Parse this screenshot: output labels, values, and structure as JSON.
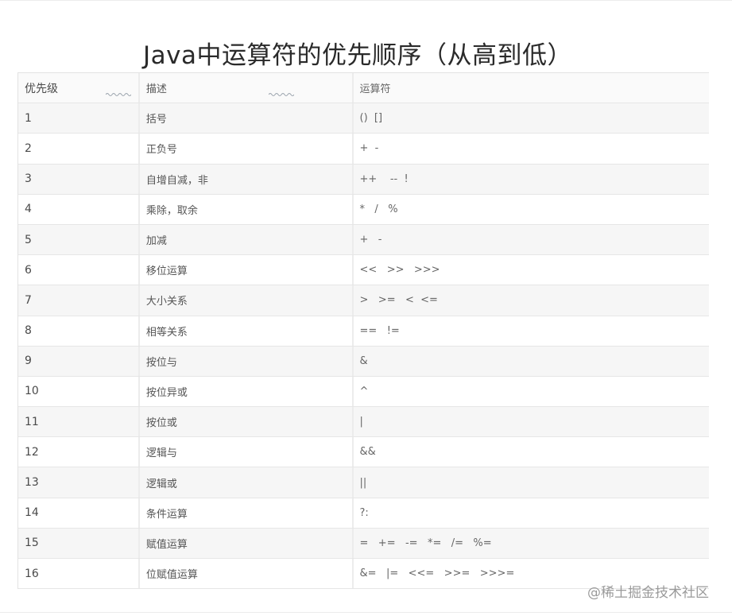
{
  "title": "Java中运算符的优先顺序（从高到低）",
  "table": {
    "headers": [
      "优先级",
      "描述",
      "运算符"
    ],
    "rows": [
      [
        "1",
        "括号",
        "()  []"
      ],
      [
        "2",
        "正负号",
        "+  -"
      ],
      [
        "3",
        "自增自减，非",
        "++    --  !"
      ],
      [
        "4",
        "乘除，取余",
        "*   /   %"
      ],
      [
        "5",
        "加减",
        "+   -"
      ],
      [
        "6",
        "移位运算",
        "<<   >>   >>>"
      ],
      [
        "7",
        "大小关系",
        ">   >=   <  <="
      ],
      [
        "8",
        "相等关系",
        "==   !="
      ],
      [
        "9",
        "按位与",
        "&"
      ],
      [
        "10",
        "按位异或",
        "^"
      ],
      [
        "11",
        "按位或",
        "|"
      ],
      [
        "12",
        "逻辑与",
        "&&"
      ],
      [
        "13",
        "逻辑或",
        "||"
      ],
      [
        "14",
        "条件运算",
        "?:"
      ],
      [
        "15",
        "赋值运算",
        "=   +=   -=   *=   /=   %="
      ],
      [
        "16",
        "位赋值运算",
        "&=   |=   <<=   >>=   >>>="
      ]
    ]
  },
  "watermark": "@稀土掘金技术社区",
  "colors": {
    "title": "#2a2a2a",
    "text": "#555555",
    "row_shade": "#f6f6f6",
    "border": "#e2e2e2",
    "watermark": "#9a9a9a"
  }
}
